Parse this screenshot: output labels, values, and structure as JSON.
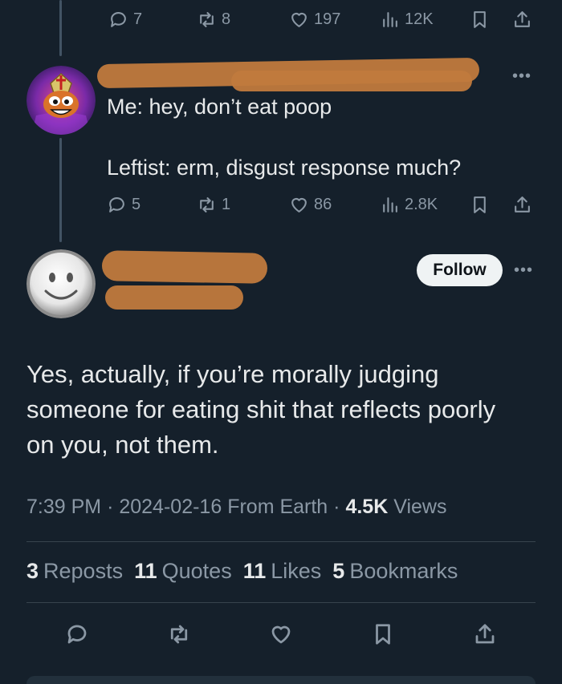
{
  "top_actions": {
    "replies": "7",
    "reposts": "8",
    "likes": "197",
    "views": "12K"
  },
  "reply": {
    "line1": "Me: hey, don’t eat poop",
    "line2": "Leftist: erm, disgust response much?",
    "replies": "5",
    "reposts": "1",
    "likes": "86",
    "views": "2.8K"
  },
  "main_post": {
    "follow_label": "Follow",
    "text": "Yes, actually, if you’re morally judging someone for eating shit that reflects poorly on you, not them.",
    "time": "7:39 PM",
    "date": "2024-02-16",
    "source": "From Earth",
    "views_count": "4.5K",
    "views_label": "Views",
    "sep": "·"
  },
  "stats": {
    "reposts_count": "3",
    "reposts_label": "Reposts",
    "quotes_count": "11",
    "quotes_label": "Quotes",
    "likes_count": "11",
    "likes_label": "Likes",
    "bookmarks_count": "5",
    "bookmarks_label": "Bookmarks"
  },
  "icons": {
    "reply": "reply-icon",
    "repost": "repost-icon",
    "like": "heart-icon",
    "views": "views-icon",
    "bookmark": "bookmark-icon",
    "share": "share-icon",
    "more": "more-icon"
  },
  "colors": {
    "background": "#15202b",
    "text": "#e7e9ea",
    "muted": "#8b98a5",
    "redaction": "#c07a3d"
  }
}
